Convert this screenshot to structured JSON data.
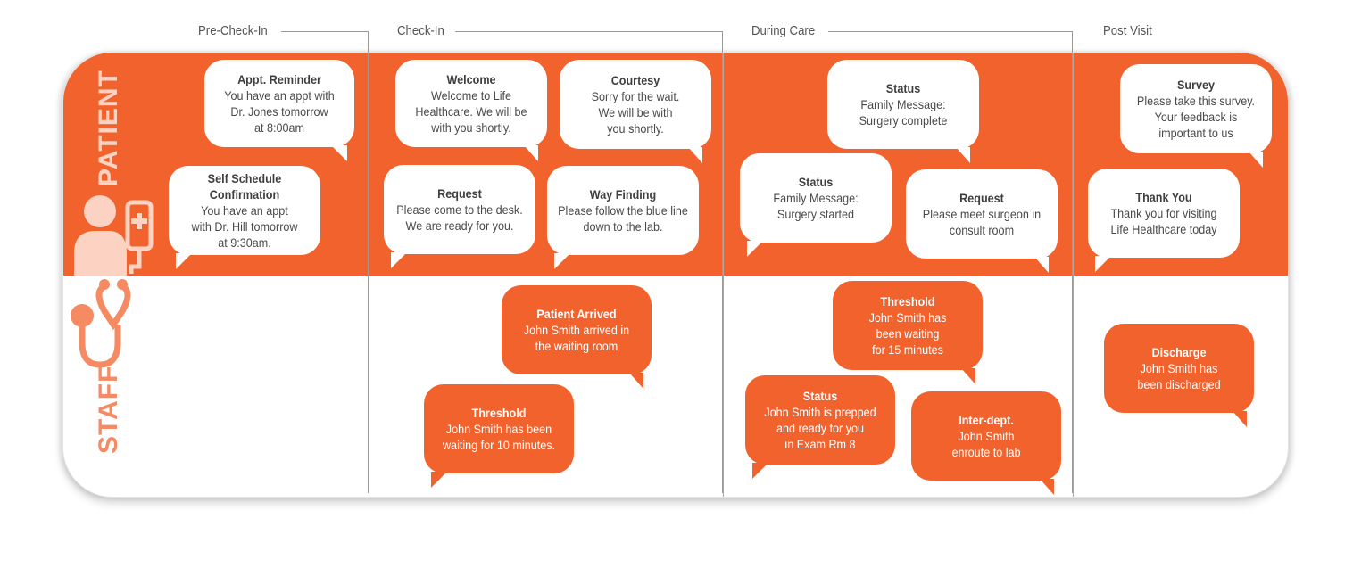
{
  "phases": [
    "Pre-Check-In",
    "Check-In",
    "During Care",
    "Post Visit"
  ],
  "lanes": {
    "patient": "PATIENT",
    "staff": "STAFF"
  },
  "colors": {
    "accent": "#f2622d",
    "light_accent": "#fcd3c2",
    "staff_icon": "#f58a63",
    "text": "#4a4a4a"
  },
  "patient_messages": [
    {
      "title": "Appt. Reminder",
      "lines": [
        "You have an appt with",
        "Dr. Jones tomorrow",
        "at 8:00am"
      ]
    },
    {
      "title": "Self Schedule Confirmation",
      "lines": [
        "You have an appt",
        "with Dr. Hill tomorrow",
        "at 9:30am."
      ]
    },
    {
      "title": "Welcome",
      "lines": [
        "Welcome to Life",
        "Healthcare. We will be",
        "with you shortly."
      ]
    },
    {
      "title": "Courtesy",
      "lines": [
        "Sorry for the wait.",
        "We will be with",
        "you shortly."
      ]
    },
    {
      "title": "Request",
      "lines": [
        "Please come to the desk.",
        "We are ready for you."
      ]
    },
    {
      "title": "Way Finding",
      "lines": [
        "Please follow the blue line",
        "down to the lab."
      ]
    },
    {
      "title": "Status",
      "lines": [
        "Family Message:",
        "Surgery complete"
      ]
    },
    {
      "title": "Status",
      "lines": [
        "Family Message:",
        "Surgery started"
      ]
    },
    {
      "title": "Request",
      "lines": [
        "Please meet surgeon in",
        "consult room"
      ]
    },
    {
      "title": "Survey",
      "lines": [
        "Please take this survey.",
        "Your feedback is",
        "important to us"
      ]
    },
    {
      "title": "Thank You",
      "lines": [
        "Thank you for visiting",
        "Life Healthcare today"
      ]
    }
  ],
  "staff_messages": [
    {
      "title": "Patient Arrived",
      "lines": [
        "John Smith arrived in",
        "the waiting room"
      ]
    },
    {
      "title": "Threshold",
      "lines": [
        "John Smith has been",
        "waiting for 10 minutes."
      ]
    },
    {
      "title": "Threshold",
      "lines": [
        "John Smith has",
        "been waiting",
        "for 15 minutes"
      ]
    },
    {
      "title": "Status",
      "lines": [
        "John Smith is prepped",
        "and ready for you",
        "in Exam Rm 8"
      ]
    },
    {
      "title": "Inter-dept.",
      "lines": [
        "John Smith",
        "enroute to lab"
      ]
    },
    {
      "title": "Discharge",
      "lines": [
        "John Smith has",
        "been discharged"
      ]
    }
  ]
}
